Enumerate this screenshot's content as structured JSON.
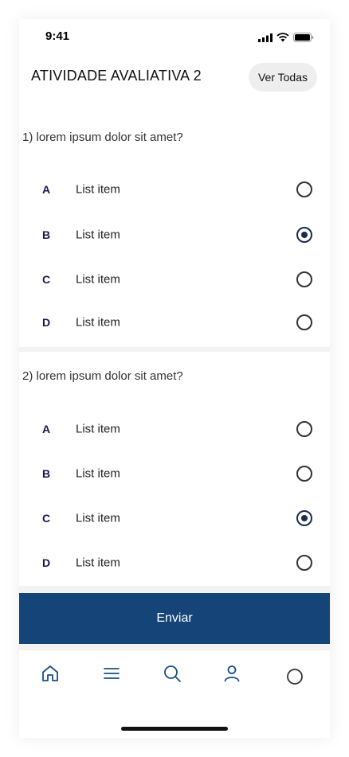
{
  "status_bar": {
    "time": "9:41",
    "icons": [
      "cellular-signal-icon",
      "wifi-icon",
      "battery-icon"
    ]
  },
  "header": {
    "title": "ATIVIDADE AVALIATIVA 2",
    "see_all_label": "Ver Todas"
  },
  "questions": [
    {
      "text": "1)  lorem ipsum dolor sit amet?",
      "options": [
        {
          "letter": "A",
          "label": "List item",
          "selected": false
        },
        {
          "letter": "B",
          "label": "List item",
          "selected": true
        },
        {
          "letter": "C",
          "label": "List item",
          "selected": false
        },
        {
          "letter": "D",
          "label": "List item",
          "selected": false
        }
      ]
    },
    {
      "text": "2)  lorem ipsum dolor sit amet?",
      "options": [
        {
          "letter": "A",
          "label": "List item",
          "selected": false
        },
        {
          "letter": "B",
          "label": "List item",
          "selected": false
        },
        {
          "letter": "C",
          "label": "List item",
          "selected": true
        },
        {
          "letter": "D",
          "label": "List item",
          "selected": false
        }
      ]
    }
  ],
  "submit_label": "Enviar",
  "tab_bar": {
    "items": [
      "home-icon",
      "menu-icon",
      "search-icon",
      "profile-icon",
      "circle-icon"
    ]
  },
  "colors": {
    "primary": "#154478",
    "radio_selected": "#1a2b4c",
    "option_letter": "#1c1450",
    "tab_icon": "#1a4f86"
  }
}
